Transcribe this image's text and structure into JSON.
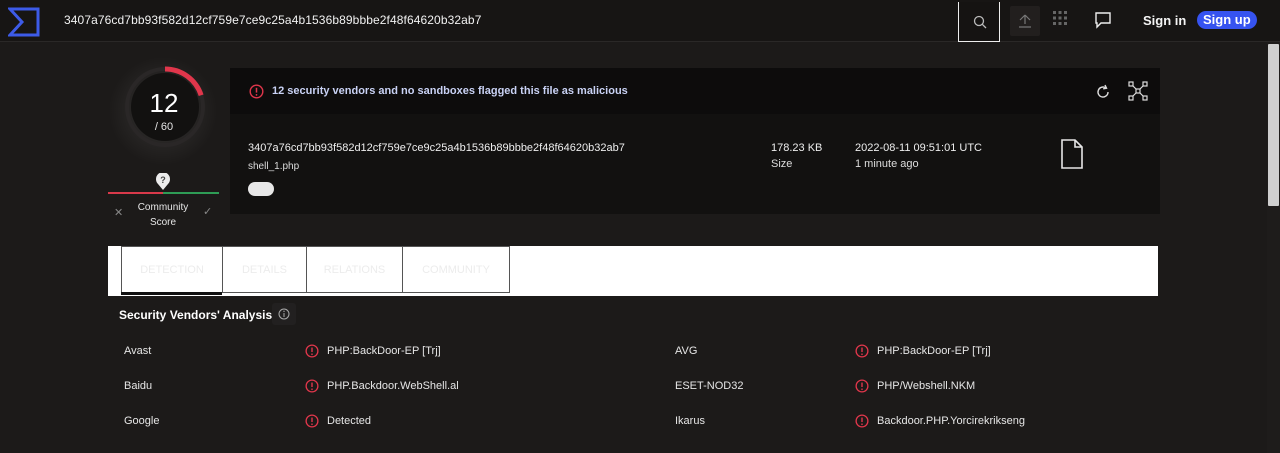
{
  "header": {
    "hash_title": "3407a76cd7bb93f582d12cf759e7ce9c25a4b1536b89bbbe2f48f64620b32ab7",
    "signin_label": "Sign in",
    "signup_label": "Sign up"
  },
  "score": {
    "detections": "12",
    "total": "/ 60",
    "fraction": 0.2,
    "community_label": "Community Score",
    "community_pin": "?"
  },
  "alert": {
    "text": "12 security vendors and no sandboxes flagged this file as malicious"
  },
  "file": {
    "hash": "3407a76cd7bb93f582d12cf759e7ce9c25a4b1536b89bbbe2f48f64620b32ab7",
    "name": "shell_1.php",
    "size_value": "178.23 KB",
    "size_label": "Size",
    "date_value": "2022-08-11 09:51:01 UTC",
    "date_ago": "1 minute ago"
  },
  "tabs": [
    "DETECTION",
    "DETAILS",
    "RELATIONS",
    "COMMUNITY"
  ],
  "vendors_section": {
    "title": "Security Vendors' Analysis"
  },
  "vendors": [
    {
      "name": "Avast",
      "result": "PHP:BackDoor-EP [Trj]"
    },
    {
      "name": "AVG",
      "result": "PHP:BackDoor-EP [Trj]"
    },
    {
      "name": "Baidu",
      "result": "PHP.Backdoor.WebShell.al"
    },
    {
      "name": "ESET-NOD32",
      "result": "PHP/Webshell.NKM"
    },
    {
      "name": "Google",
      "result": "Detected"
    },
    {
      "name": "Ikarus",
      "result": "Backdoor.PHP.Yorcirekrikseng"
    }
  ],
  "colors": {
    "accent": "#3653f0",
    "malicious": "#d9394a",
    "harmless": "#2e9c55"
  }
}
